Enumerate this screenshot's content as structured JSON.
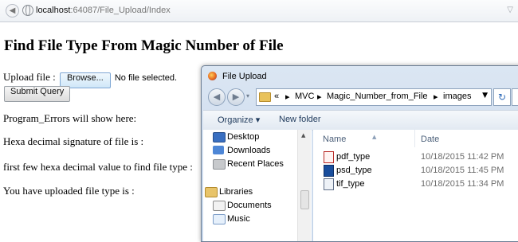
{
  "browser": {
    "url_host": "localhost",
    "url_rest": ":64087/File_Upload/Index"
  },
  "page": {
    "title": "Find File Type From Magic Number of File",
    "upload_label": "Upload file :",
    "browse_label": "Browse...",
    "no_file_text": "No file selected.",
    "submit_label": "Submit Query",
    "errors_text": "Program_Errors will show here:",
    "hex_signature_text": "Hexa decimal signature of file is :",
    "first_hex_text": "first few hexa decimal value to find file type :",
    "uploaded_type_text": "You have uploaded file type is :"
  },
  "dialog": {
    "title": "File Upload",
    "path": {
      "prefix": "«",
      "segments": [
        "MVC",
        "Magic_Number_from_File",
        "images"
      ],
      "separator": "▸"
    },
    "toolbar": {
      "organize": "Organize ▾",
      "new_folder": "New folder"
    },
    "nav_items": [
      {
        "label": "Desktop",
        "icon": "desktop-icon"
      },
      {
        "label": "Downloads",
        "icon": "downloads-icon"
      },
      {
        "label": "Recent Places",
        "icon": "recent-places-icon"
      },
      {
        "label": "Libraries",
        "icon": "libraries-icon"
      },
      {
        "label": "Documents",
        "icon": "documents-icon"
      },
      {
        "label": "Music",
        "icon": "music-icon"
      }
    ],
    "columns": {
      "name": "Name",
      "date": "Date"
    },
    "files": [
      {
        "name": "pdf_type",
        "date": "10/18/2015 11:42 PM",
        "icon": "pdf-file-icon"
      },
      {
        "name": "psd_type",
        "date": "10/18/2015 11:45 PM",
        "icon": "psd-file-icon"
      },
      {
        "name": "tif_type",
        "date": "10/18/2015 11:34 PM",
        "icon": "tif-file-icon"
      }
    ]
  }
}
